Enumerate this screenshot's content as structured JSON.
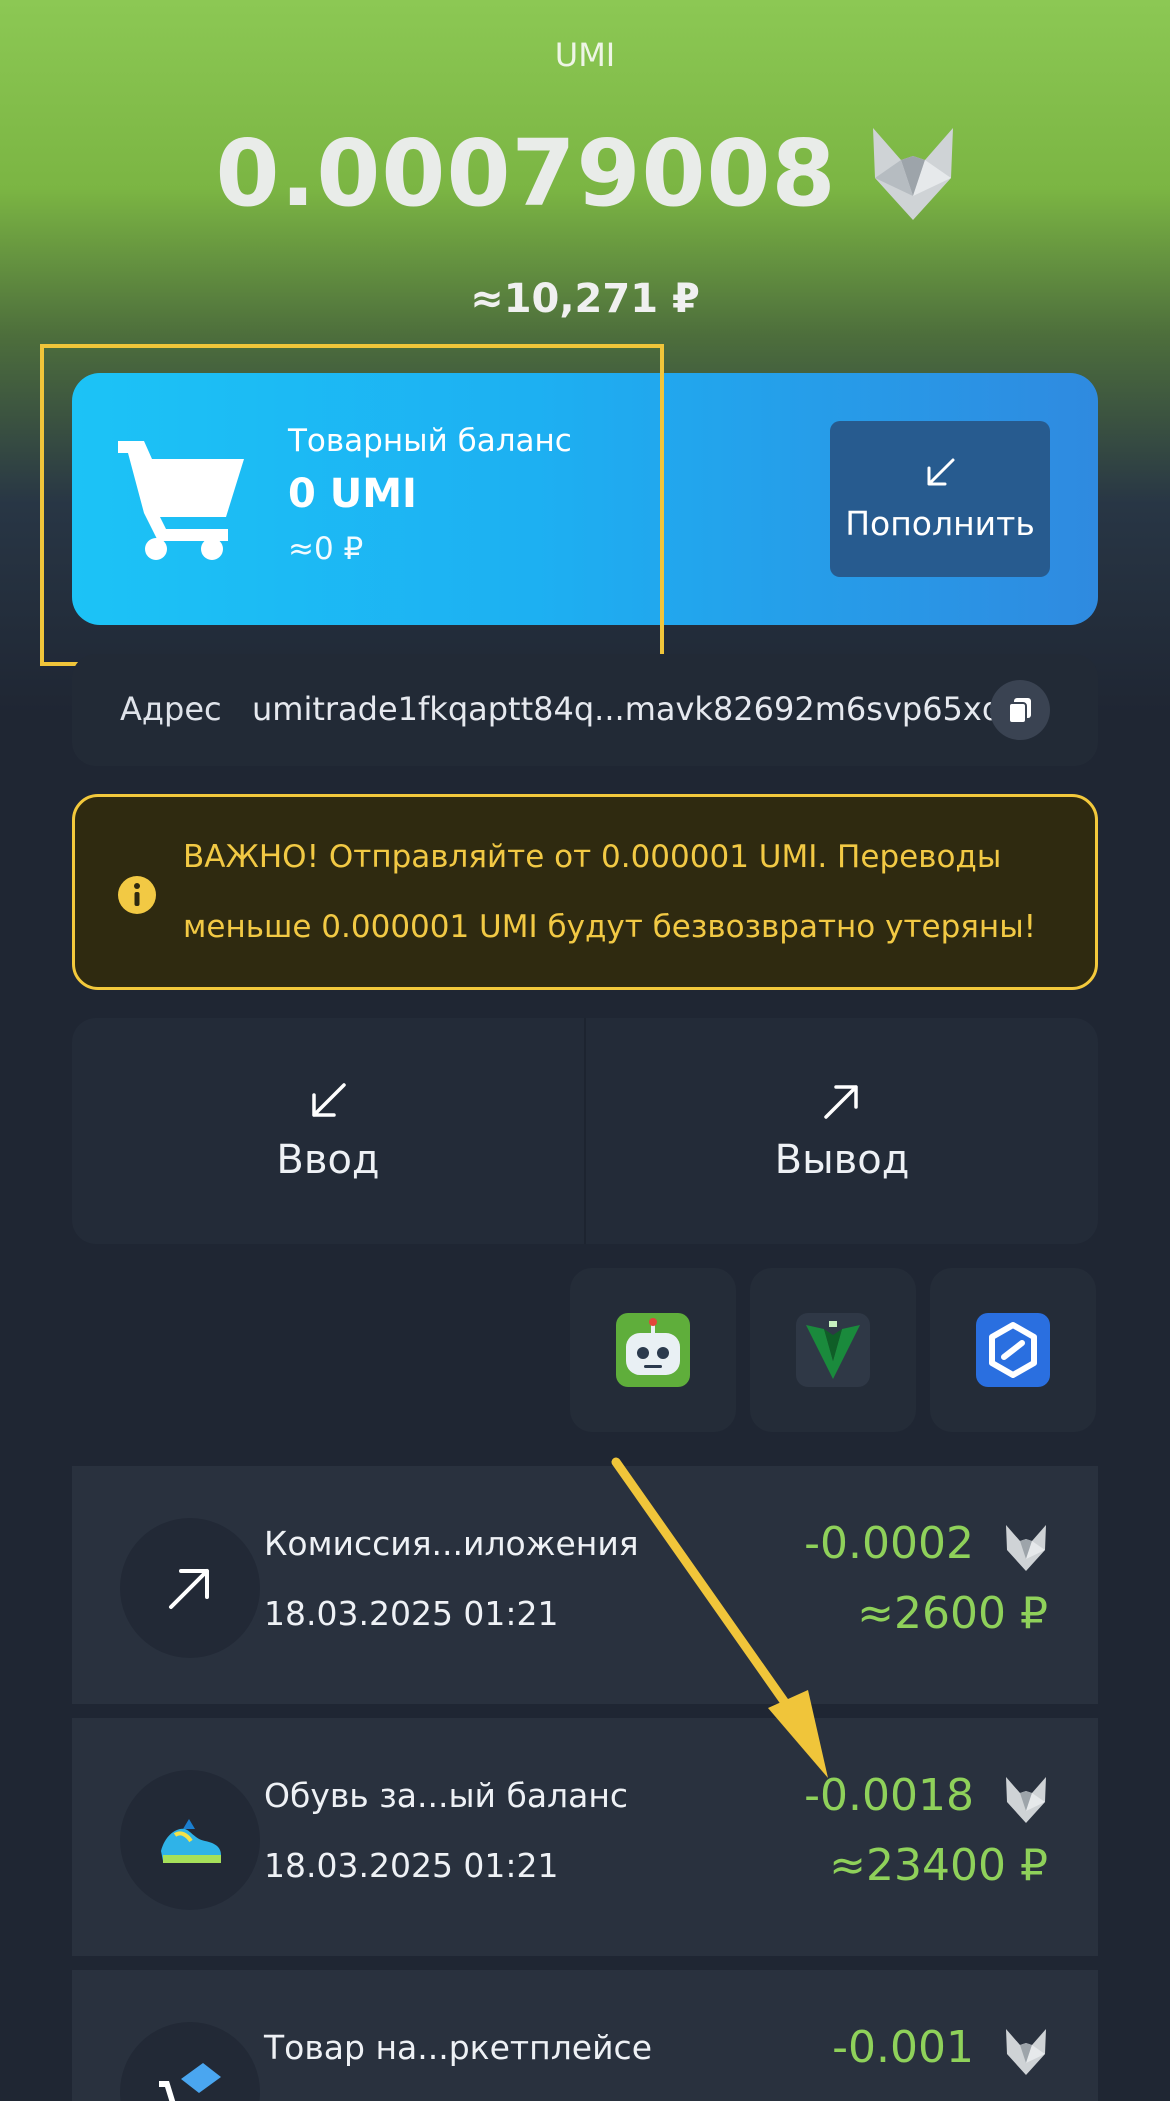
{
  "header": {
    "coin": "UMI",
    "balance": "0.00079008",
    "balance_fiat": "≈10,271 ₽"
  },
  "goods_card": {
    "label": "Товарный баланс",
    "amount": "0 UMI",
    "fiat": "≈0 ₽",
    "topup_label": "Пополнить"
  },
  "address": {
    "label": "Адрес",
    "value": "umitrade1fkqaptt84q...mavk82692m6svp65xd"
  },
  "warning": {
    "line1": "ВАЖНО! Отправляйте от 0.000001 UMI. Переводы",
    "line2": "меньше 0.000001 UMI будут безвозвратно утеряны!"
  },
  "actions": {
    "deposit_label": "Ввод",
    "withdraw_label": "Вывод"
  },
  "apps": [
    {
      "name": "robot-app-icon"
    },
    {
      "name": "v-logo-app-icon"
    },
    {
      "name": "blue-hex-app-icon"
    }
  ],
  "transactions": [
    {
      "title": "Комиссия...иложения",
      "date": "18.03.2025 01:21",
      "amount": "-0.0002",
      "fiat": "≈2600 ₽",
      "icon": "arrow-up-right-icon"
    },
    {
      "title": "Обувь за...ый баланс",
      "date": "18.03.2025 01:21",
      "amount": "-0.0018",
      "fiat": "≈23400 ₽",
      "icon": "sneaker-icon"
    },
    {
      "title": "Товар на...ркетплейсе",
      "date": "",
      "amount": "-0.001",
      "fiat": "",
      "icon": "cart-bag-icon"
    }
  ],
  "colors": {
    "accent_green": "#8fd15a",
    "warning_yellow": "#f2c944",
    "card_blue": "#1db0f2",
    "highlight": "#f0c53a"
  }
}
